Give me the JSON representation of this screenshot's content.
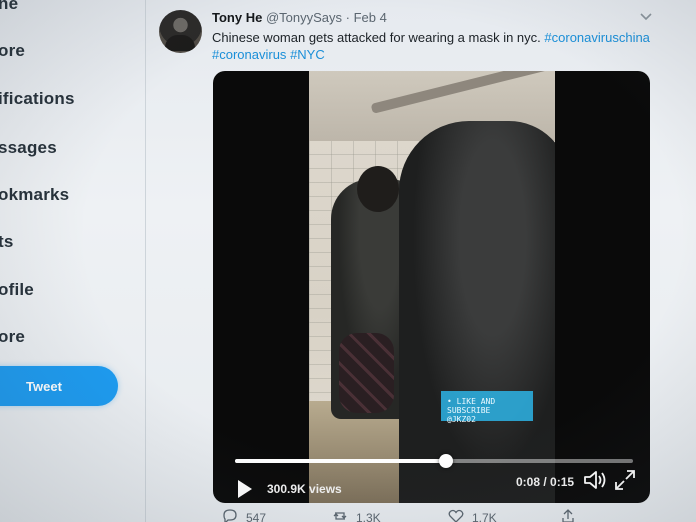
{
  "sidebar": {
    "items": [
      {
        "label": "ne",
        "icon": "home-icon"
      },
      {
        "label": "ore",
        "icon": "explore-icon"
      },
      {
        "label": "ifications",
        "icon": "bell-icon"
      },
      {
        "label": "ssages",
        "icon": "mail-icon"
      },
      {
        "label": "okmarks",
        "icon": "bookmark-icon"
      },
      {
        "label": "ts",
        "icon": "list-icon"
      },
      {
        "label": "ofile",
        "icon": "person-icon"
      },
      {
        "label": "ore",
        "icon": "more-icon"
      }
    ],
    "tweet_button": "Tweet"
  },
  "tweet": {
    "author_name": "Tony He",
    "handle": "@TonyySays",
    "separator": "·",
    "date": "Feb 4",
    "text": "Chinese woman gets attacked for wearing a mask in nyc.",
    "hashtags": [
      "#coronaviruschina",
      "#coronavirus",
      "#NYC"
    ],
    "menu_icon": "chevron-down-icon"
  },
  "video": {
    "views": "300.9K views",
    "time": "0:08 / 0:15",
    "progress": 0.53,
    "overlay_text": "• LIKE AND SUBSCRIBE\n@JKZ02"
  },
  "actions": [
    {
      "icon": "reply-icon",
      "count": "547"
    },
    {
      "icon": "retweet-icon",
      "count": "1.3K"
    },
    {
      "icon": "heart-icon",
      "count": "1.7K"
    },
    {
      "icon": "share-icon",
      "count": ""
    }
  ],
  "colors": {
    "accent": "#1d9bf0",
    "hashtag": "#1a8fd8"
  }
}
